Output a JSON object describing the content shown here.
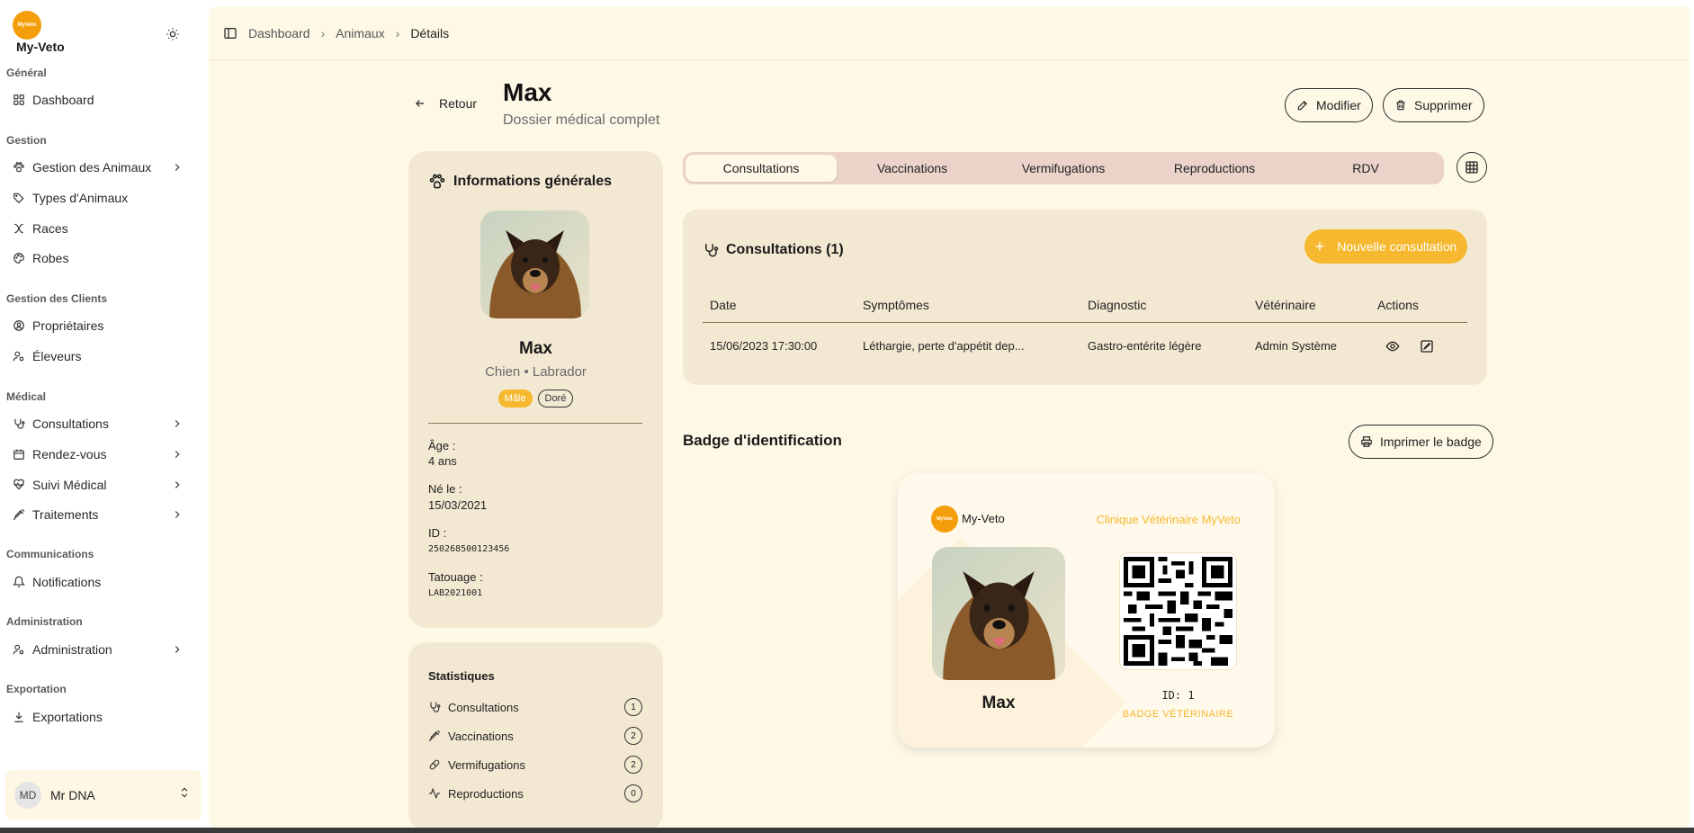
{
  "brand": {
    "logo_text": "MyVeto",
    "name": "My-Veto"
  },
  "sidebar": {
    "sections": [
      {
        "label": "Général"
      },
      {
        "label": "Gestion"
      },
      {
        "label": "Gestion des Clients"
      },
      {
        "label": "Médical"
      },
      {
        "label": "Communications"
      },
      {
        "label": "Administration"
      },
      {
        "label": "Exportation"
      }
    ],
    "items": [
      {
        "label": "Dashboard",
        "icon": "grid-icon"
      },
      {
        "label": "Gestion des Animaux",
        "icon": "paw-icon"
      },
      {
        "label": "Types d'Animaux",
        "icon": "tags-icon"
      },
      {
        "label": "Races",
        "icon": "dna-icon"
      },
      {
        "label": "Robes",
        "icon": "palette-icon"
      },
      {
        "label": "Propriétaires",
        "icon": "user-circle-icon"
      },
      {
        "label": "Éleveurs",
        "icon": "user-cog-icon"
      },
      {
        "label": "Consultations",
        "icon": "stethoscope-icon"
      },
      {
        "label": "Rendez-vous",
        "icon": "calendar-icon"
      },
      {
        "label": "Suivi Médical",
        "icon": "heart-pulse-icon"
      },
      {
        "label": "Traitements",
        "icon": "syringe-icon"
      },
      {
        "label": "Notifications",
        "icon": "bell-icon"
      },
      {
        "label": "Administration",
        "icon": "user-cog-icon"
      },
      {
        "label": "Exportations",
        "icon": "download-icon"
      }
    ]
  },
  "user": {
    "initials": "MD",
    "name": "Mr DNA"
  },
  "breadcrumb": {
    "items": [
      "Dashboard",
      "Animaux"
    ],
    "current": "Détails"
  },
  "header": {
    "back_label": "Retour",
    "title": "Max",
    "subtitle": "Dossier médical complet",
    "edit_label": "Modifier",
    "delete_label": "Supprimer"
  },
  "info": {
    "title": "Informations générales",
    "name": "Max",
    "species": "Chien • Labrador",
    "sex": "Mâle",
    "coat": "Doré",
    "fields": [
      {
        "label": "Âge :",
        "value": "4 ans"
      },
      {
        "label": "Né le :",
        "value": "15/03/2021"
      },
      {
        "label": "ID :",
        "value": "250268500123456"
      },
      {
        "label": "Tatouage :",
        "value": "LAB2021001"
      }
    ]
  },
  "stats": {
    "title": "Statistiques",
    "rows": [
      {
        "label": "Consultations",
        "count": "1"
      },
      {
        "label": "Vaccinations",
        "count": "2"
      },
      {
        "label": "Vermifugations",
        "count": "2"
      },
      {
        "label": "Reproductions",
        "count": "0"
      }
    ]
  },
  "tabs": [
    "Consultations",
    "Vaccinations",
    "Vermifugations",
    "Reproductions",
    "RDV"
  ],
  "consultations": {
    "title": "Consultations (1)",
    "new_button": "Nouvelle consultation",
    "headers": [
      "Date",
      "Symptômes",
      "Diagnostic",
      "Vétérinaire",
      "Actions"
    ],
    "rows": [
      {
        "date": "15/06/2023 17:30:00",
        "symptoms": "Léthargie, perte d'appétit dep...",
        "diagnosis": "Gastro-entérite légère",
        "vet": "Admin Système"
      }
    ]
  },
  "badge": {
    "heading": "Badge d'identification",
    "print_label": "Imprimer le badge",
    "brand": "My-Veto",
    "clinic": "Clinique Vétérinaire MyVeto",
    "name": "Max",
    "id_text": "ID: 1",
    "label": "BADGE VÉTÉRINAIRE"
  },
  "colors": {
    "accent": "#f5b82e",
    "background": "#fef8e6",
    "card": "#f3e9d2",
    "tabs": "#ebd3ca"
  }
}
